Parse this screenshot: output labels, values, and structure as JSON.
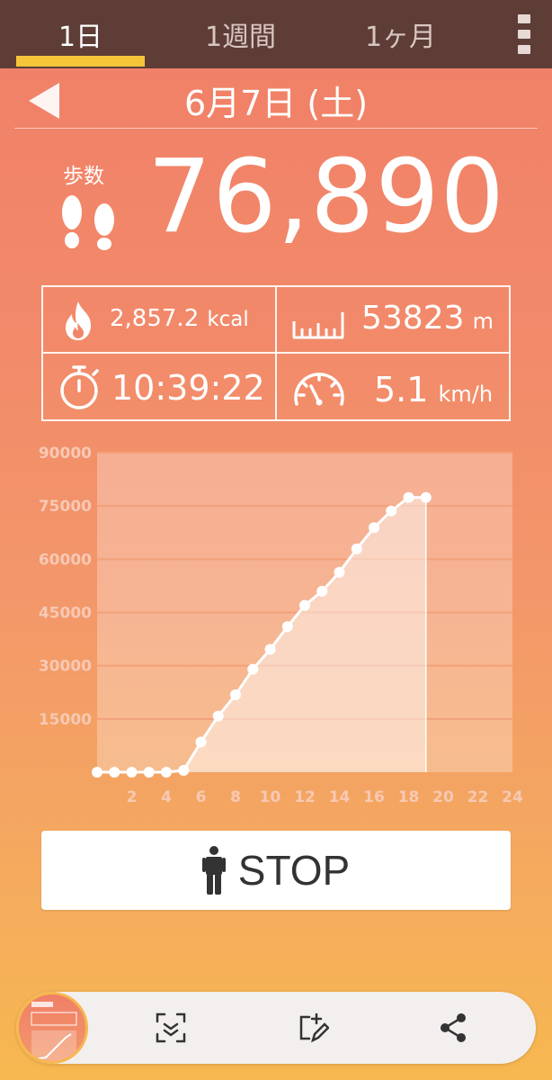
{
  "tabs": [
    {
      "label": "1日",
      "active": true
    },
    {
      "label": "1週間",
      "active": false
    },
    {
      "label": "1ヶ月",
      "active": false
    }
  ],
  "header": {
    "date": "6月7日 (土)"
  },
  "steps": {
    "label": "歩数",
    "value": "76,890"
  },
  "stats": {
    "calories": {
      "value": "2,857.2",
      "unit": "kcal",
      "icon": "flame-icon"
    },
    "distance": {
      "value": "53823",
      "unit": "m",
      "icon": "ruler-icon"
    },
    "duration": {
      "value": "10:39:22",
      "icon": "stopwatch-icon"
    },
    "speed": {
      "value": "5.1",
      "unit": "km/h",
      "icon": "speedometer-icon"
    }
  },
  "chart_data": {
    "type": "area",
    "x": [
      0,
      1,
      2,
      3,
      4,
      5,
      6,
      7,
      8,
      9,
      10,
      11,
      12,
      13,
      14,
      15,
      16,
      17,
      18,
      19
    ],
    "values": [
      0,
      0,
      0,
      0,
      0,
      500,
      8500,
      15800,
      21800,
      29000,
      34600,
      41000,
      47000,
      51000,
      56300,
      62900,
      68900,
      73600,
      77400,
      77400
    ],
    "xlim": [
      0,
      24
    ],
    "ylim": [
      0,
      90000
    ],
    "yticks": [
      15000,
      30000,
      45000,
      60000,
      75000,
      90000
    ],
    "xticks": [
      2,
      4,
      6,
      8,
      10,
      12,
      14,
      16,
      18,
      20,
      22,
      24
    ],
    "grid": true,
    "colors": {
      "line": "#ffffff",
      "grid": "#f3a07a",
      "fill": "rgba(255,255,255,0.45)",
      "plot_bg": "rgba(255,255,255,0.28)",
      "tick_label": "#f7c9b4"
    }
  },
  "stop_button": {
    "label": "STOP",
    "icon": "walking-person-icon"
  },
  "toolbar": {
    "items": [
      "screenshot-thumbnail",
      "scroll-capture-icon",
      "edit-icon",
      "share-icon"
    ]
  },
  "colors": {
    "tabbar": "#5d3d36",
    "indicator": "#f7c53a",
    "accent": "#f07f67"
  }
}
